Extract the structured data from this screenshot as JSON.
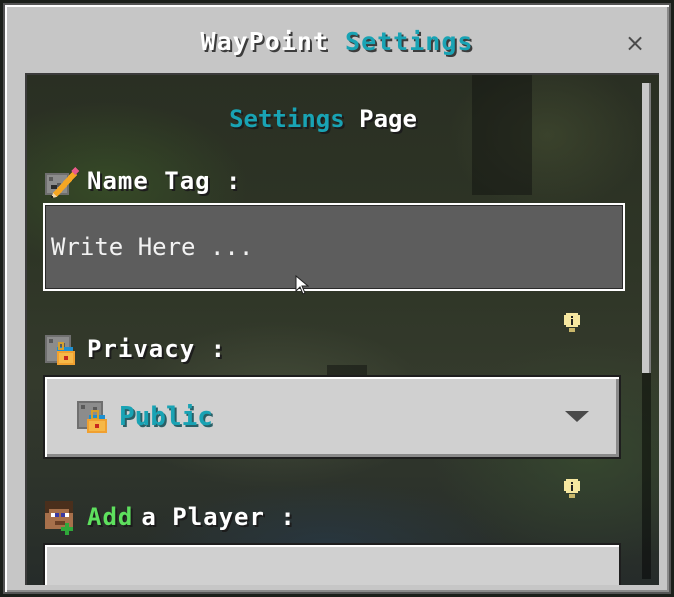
{
  "window": {
    "title_part1": "WayPoint",
    "title_part2": "Settings",
    "close_symbol": "×"
  },
  "page": {
    "heading_part1": "Settings",
    "heading_part2": "Page"
  },
  "name_tag": {
    "label": "Name Tag :",
    "icon": "pencil-icon",
    "input_value": "",
    "input_placeholder": "Write Here ..."
  },
  "privacy": {
    "label": "Privacy :",
    "icon": "lock-icon",
    "selected_value": "Public",
    "info_icon": "info-icon"
  },
  "add_player": {
    "label_part1": "Add",
    "label_part2": "a Player :",
    "icon": "player-add-icon",
    "info_icon": "info-icon"
  },
  "colors": {
    "accent": "#19a3b4",
    "green": "#5ee05e",
    "panel": "#c6c6c6",
    "input_bg": "#5d5d5d"
  }
}
